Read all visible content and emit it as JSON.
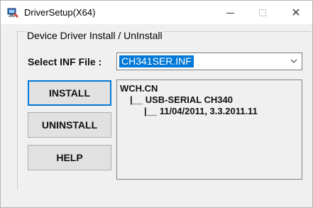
{
  "window": {
    "title": "DriverSetup(X64)",
    "controls": {
      "minimize": "–",
      "maximize": "□",
      "close": "✕"
    }
  },
  "group": {
    "title": "Device Driver Install / UnInstall"
  },
  "inf": {
    "label": "Select INF File :",
    "selected": "CH341SER.INF"
  },
  "buttons": {
    "install": "INSTALL",
    "uninstall": "UNINSTALL",
    "help": "HELP"
  },
  "info": {
    "lines": [
      "WCH.CN",
      "|__ USB-SERIAL CH340",
      "|__ 11/04/2011, 3.3.2011.11"
    ]
  },
  "colors": {
    "selection": "#0078d7",
    "button_face": "#e1e1e1"
  },
  "icons": {
    "app": "usb-driver-setup-icon",
    "dropdown": "chevron-down-icon"
  }
}
